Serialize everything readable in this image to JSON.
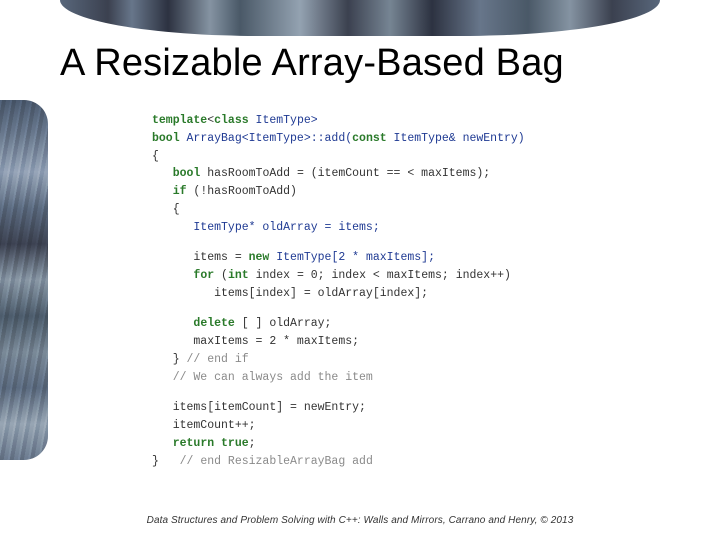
{
  "title": "A Resizable Array-Based Bag",
  "footer": "Data Structures and Problem Solving with C++: Walls and Mirrors, Carrano and Henry, ©  2013",
  "code": {
    "l01_a": "template",
    "l01_b": "<",
    "l01_c": "class",
    "l01_d": " ItemType>",
    "l02_a": "bool",
    "l02_b": " ArrayBag<ItemType>::add(",
    "l02_c": "const",
    "l02_d": " ItemType& newEntry)",
    "l03": "{",
    "l04_a": "   ",
    "l04_b": "bool",
    "l04_c": " hasRoomToAdd = (itemCount == < maxItems);",
    "l05_a": "   ",
    "l05_b": "if",
    "l05_c": " (!hasRoomToAdd)",
    "l06": "   {",
    "l07": "      ItemType* oldArray = items;",
    "l08_a": "      items = ",
    "l08_b": "new",
    "l08_c": " ItemType[2 * maxItems];",
    "l09_a": "      ",
    "l09_b": "for",
    "l09_c": " (",
    "l09_d": "int",
    "l09_e": " index = 0; index < maxItems; index++)",
    "l10": "         items[index] = oldArray[index];",
    "l11_a": "      ",
    "l11_b": "delete",
    "l11_c": " [ ] oldArray;",
    "l12": "      maxItems = 2 * maxItems;",
    "l13_a": "   } ",
    "l13_b": "// end if",
    "l14": "   // We can always add the item",
    "l15": "   items[itemCount] = newEntry;",
    "l16": "   itemCount++;",
    "l17_a": "   ",
    "l17_b": "return true",
    "l17_c": ";",
    "l18_a": "}   ",
    "l18_b": "// end ResizableArrayBag add"
  }
}
